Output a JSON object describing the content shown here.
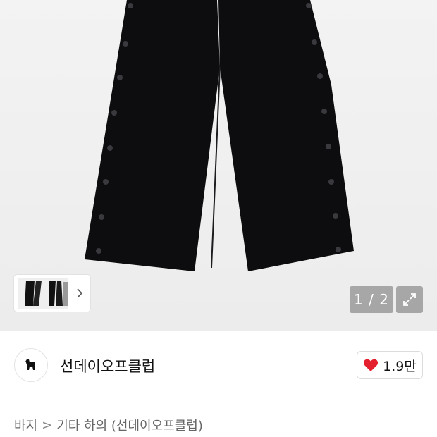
{
  "gallery": {
    "counter": "1 / 2"
  },
  "brand": {
    "name": "선데이오프클럽",
    "likes": "1.9만"
  },
  "breadcrumb": {
    "items": [
      "바지",
      "기타 하의 (선데이오프클럽)"
    ],
    "separator": ">"
  },
  "colors": {
    "like_heart": "#e5202e",
    "text_primary": "#111111",
    "text_secondary": "#666666"
  },
  "icons": {
    "expand": "expand-icon",
    "heart": "heart-icon",
    "chevron": "chevron-right-icon"
  }
}
